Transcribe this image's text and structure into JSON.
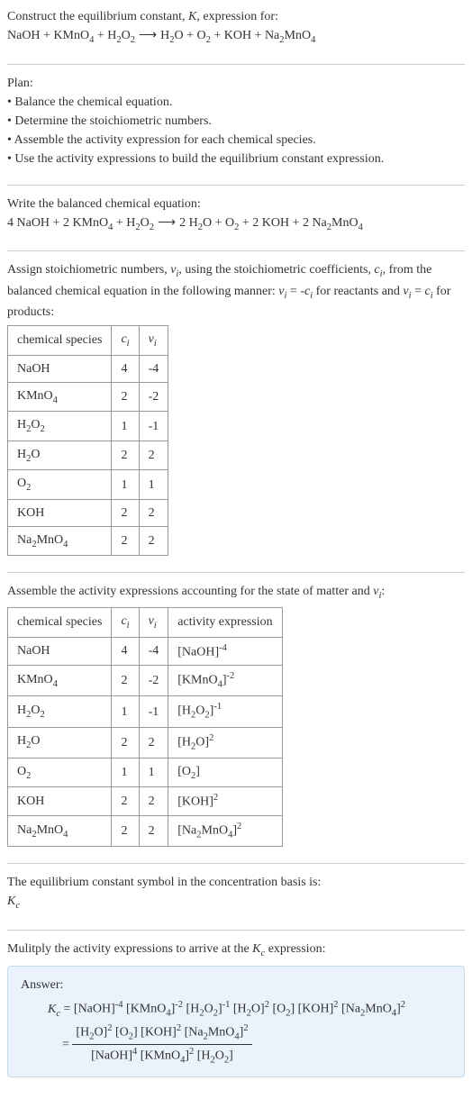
{
  "intro": {
    "line1": "Construct the equilibrium constant, K, expression for:",
    "line2": "NaOH + KMnO₄ + H₂O₂  ⟶  H₂O + O₂ + KOH + Na₂MnO₄"
  },
  "plan": {
    "title": "Plan:",
    "items": [
      "• Balance the chemical equation.",
      "• Determine the stoichiometric numbers.",
      "• Assemble the activity expression for each chemical species.",
      "• Use the activity expressions to build the equilibrium constant expression."
    ]
  },
  "balanced": {
    "title": "Write the balanced chemical equation:",
    "eq": "4 NaOH + 2 KMnO₄ + H₂O₂  ⟶  2 H₂O + O₂ + 2 KOH + 2 Na₂MnO₄"
  },
  "assign": {
    "text1": "Assign stoichiometric numbers, νᵢ, using the stoichiometric coefficients, cᵢ, from the balanced chemical equation in the following manner: νᵢ = -cᵢ for reactants and νᵢ = cᵢ for products:",
    "table": {
      "headers": [
        "chemical species",
        "cᵢ",
        "νᵢ"
      ],
      "rows": [
        [
          "NaOH",
          "4",
          "-4"
        ],
        [
          "KMnO₄",
          "2",
          "-2"
        ],
        [
          "H₂O₂",
          "1",
          "-1"
        ],
        [
          "H₂O",
          "2",
          "2"
        ],
        [
          "O₂",
          "1",
          "1"
        ],
        [
          "KOH",
          "2",
          "2"
        ],
        [
          "Na₂MnO₄",
          "2",
          "2"
        ]
      ]
    }
  },
  "assemble": {
    "title": "Assemble the activity expressions accounting for the state of matter and νᵢ:",
    "table": {
      "headers": [
        "chemical species",
        "cᵢ",
        "νᵢ",
        "activity expression"
      ],
      "rows": [
        [
          "NaOH",
          "4",
          "-4",
          "[NaOH]⁻⁴"
        ],
        [
          "KMnO₄",
          "2",
          "-2",
          "[KMnO₄]⁻²"
        ],
        [
          "H₂O₂",
          "1",
          "-1",
          "[H₂O₂]⁻¹"
        ],
        [
          "H₂O",
          "2",
          "2",
          "[H₂O]²"
        ],
        [
          "O₂",
          "1",
          "1",
          "[O₂]"
        ],
        [
          "KOH",
          "2",
          "2",
          "[KOH]²"
        ],
        [
          "Na₂MnO₄",
          "2",
          "2",
          "[Na₂MnO₄]²"
        ]
      ]
    }
  },
  "symbol": {
    "text": "The equilibrium constant symbol in the concentration basis is:",
    "kc": "K_c"
  },
  "multiply": {
    "text": "Mulitply the activity expressions to arrive at the K_c expression:"
  },
  "answer": {
    "label": "Answer:",
    "kc_line1": "K_c = [NaOH]⁻⁴ [KMnO₄]⁻² [H₂O₂]⁻¹ [H₂O]² [O₂] [KOH]² [Na₂MnO₄]²",
    "num": "[H₂O]² [O₂] [KOH]² [Na₂MnO₄]²",
    "den": "[NaOH]⁴ [KMnO₄]² [H₂O₂]"
  },
  "chart_data": {
    "type": "table",
    "tables": [
      {
        "title": "Stoichiometric numbers",
        "headers": [
          "chemical species",
          "c_i",
          "nu_i"
        ],
        "rows": [
          {
            "species": "NaOH",
            "c_i": 4,
            "nu_i": -4
          },
          {
            "species": "KMnO4",
            "c_i": 2,
            "nu_i": -2
          },
          {
            "species": "H2O2",
            "c_i": 1,
            "nu_i": -1
          },
          {
            "species": "H2O",
            "c_i": 2,
            "nu_i": 2
          },
          {
            "species": "O2",
            "c_i": 1,
            "nu_i": 1
          },
          {
            "species": "KOH",
            "c_i": 2,
            "nu_i": 2
          },
          {
            "species": "Na2MnO4",
            "c_i": 2,
            "nu_i": 2
          }
        ]
      },
      {
        "title": "Activity expressions",
        "headers": [
          "chemical species",
          "c_i",
          "nu_i",
          "activity expression"
        ],
        "rows": [
          {
            "species": "NaOH",
            "c_i": 4,
            "nu_i": -4,
            "activity": "[NaOH]^-4"
          },
          {
            "species": "KMnO4",
            "c_i": 2,
            "nu_i": -2,
            "activity": "[KMnO4]^-2"
          },
          {
            "species": "H2O2",
            "c_i": 1,
            "nu_i": -1,
            "activity": "[H2O2]^-1"
          },
          {
            "species": "H2O",
            "c_i": 2,
            "nu_i": 2,
            "activity": "[H2O]^2"
          },
          {
            "species": "O2",
            "c_i": 1,
            "nu_i": 1,
            "activity": "[O2]"
          },
          {
            "species": "KOH",
            "c_i": 2,
            "nu_i": 2,
            "activity": "[KOH]^2"
          },
          {
            "species": "Na2MnO4",
            "c_i": 2,
            "nu_i": 2,
            "activity": "[Na2MnO4]^2"
          }
        ]
      }
    ]
  }
}
